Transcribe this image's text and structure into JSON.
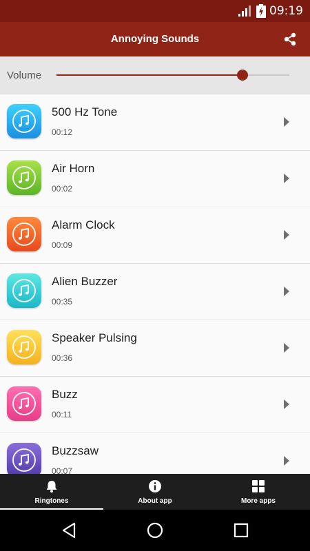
{
  "status_bar": {
    "time": "09:19"
  },
  "app_bar": {
    "title": "Annoying Sounds",
    "share_icon": "share-icon"
  },
  "volume": {
    "label": "Volume",
    "level": 0.8
  },
  "sounds": [
    {
      "title": "500 Hz Tone",
      "duration": "00:12",
      "color_top": "#3fd0ff",
      "color_bottom": "#1a8fe0"
    },
    {
      "title": "Air Horn",
      "duration": "00:02",
      "color_top": "#a9e04a",
      "color_bottom": "#5bb526"
    },
    {
      "title": "Alarm Clock",
      "duration": "00:09",
      "color_top": "#ff8a3d",
      "color_bottom": "#e84a1c"
    },
    {
      "title": "Alien Buzzer",
      "duration": "00:35",
      "color_top": "#5fe7e3",
      "color_bottom": "#19b8c8"
    },
    {
      "title": "Speaker Pulsing",
      "duration": "00:36",
      "color_top": "#ffe05a",
      "color_bottom": "#f5b21c"
    },
    {
      "title": "Buzz",
      "duration": "00:11",
      "color_top": "#ff6fb0",
      "color_bottom": "#e83c8a"
    },
    {
      "title": "Buzzsaw",
      "duration": "00:07",
      "color_top": "#8a6fdc",
      "color_bottom": "#4f3aa8"
    }
  ],
  "bottom_nav": [
    {
      "label": "Ringtones",
      "icon": "bell-icon",
      "active": true
    },
    {
      "label": "About app",
      "icon": "info-icon",
      "active": false
    },
    {
      "label": "More apps",
      "icon": "grid-icon",
      "active": false
    }
  ],
  "colors": {
    "primary": "#8f2417",
    "status_bar": "#7a1a10"
  }
}
